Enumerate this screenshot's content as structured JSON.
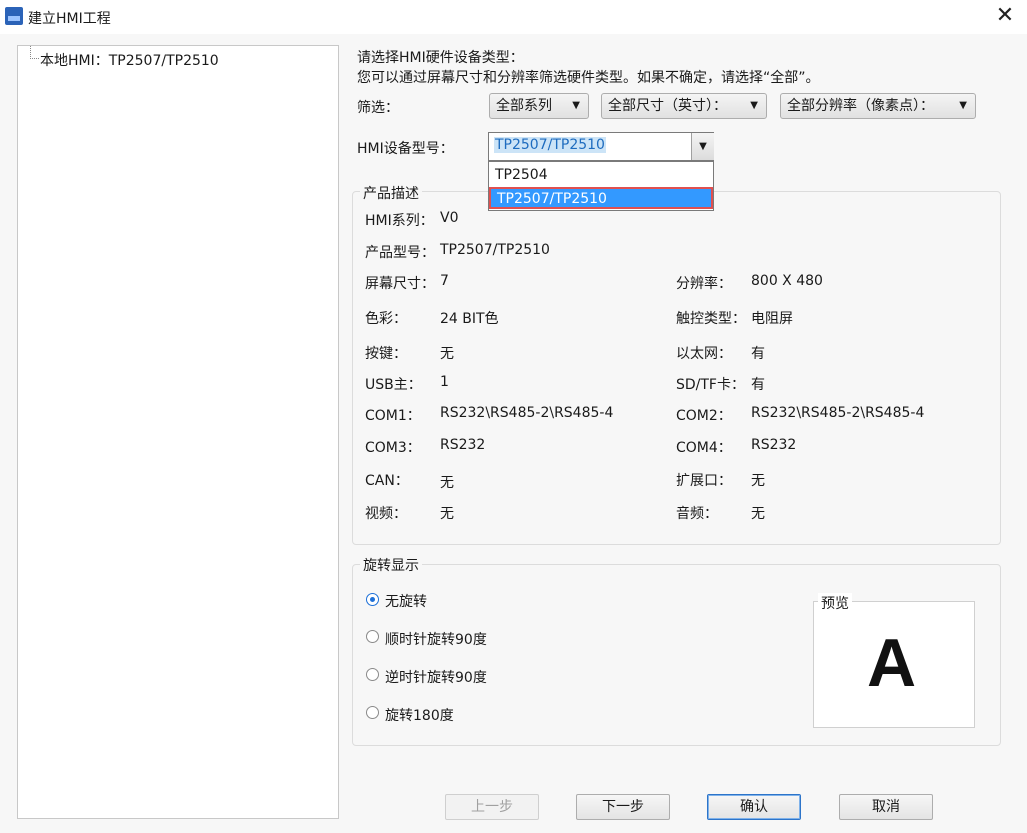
{
  "window": {
    "title": "建立HMI工程",
    "close_glyph": "✕"
  },
  "tree": {
    "item": "本地HMI：TP2507/TP2510"
  },
  "instructions": {
    "line1": "请选择HMI硬件设备类型：",
    "line2": "您可以通过屏幕尺寸和分辨率筛选硬件类型。如果不确定，请选择“全部”。"
  },
  "filter": {
    "label": "筛选：",
    "series": "全部系列",
    "size": "全部尺寸（英寸）：",
    "resolution": "全部分辨率（像素点）："
  },
  "device": {
    "label": "HMI设备型号：",
    "value": "TP2507/TP2510",
    "options": [
      "TP2504",
      "TP2507/TP2510"
    ],
    "selected_index": 1
  },
  "product": {
    "group_title": "产品描述",
    "series_label": "HMI系列：",
    "series_value": "V0",
    "model_label": "产品型号：",
    "model_value": "TP2507/TP2510",
    "screen_label": "屏幕尺寸：",
    "screen_value": "7",
    "resolution_label": "分辨率：",
    "resolution_value": "800 X 480",
    "color_label": "色彩：",
    "color_value": "24 BIT色",
    "touch_label": "触控类型：",
    "touch_value": "电阻屏",
    "keys_label": "按键：",
    "keys_value": "无",
    "ethernet_label": "以太网：",
    "ethernet_value": "有",
    "usb_label": "USB主：",
    "usb_value": "1",
    "sd_label": "SD/TF卡：",
    "sd_value": "有",
    "com1_label": "COM1：",
    "com1_value": "RS232\\RS485-2\\RS485-4",
    "com2_label": "COM2：",
    "com2_value": "RS232\\RS485-2\\RS485-4",
    "com3_label": "COM3：",
    "com3_value": "RS232",
    "com4_label": "COM4：",
    "com4_value": "RS232",
    "can_label": "CAN：",
    "can_value": "无",
    "expansion_label": "扩展口：",
    "expansion_value": "无",
    "video_label": "视频：",
    "video_value": "无",
    "audio_label": "音频：",
    "audio_value": "无"
  },
  "rotation": {
    "group_title": "旋转显示",
    "options": [
      "无旋转",
      "顺时针旋转90度",
      "逆时针旋转90度",
      "旋转180度"
    ],
    "selected_index": 0,
    "preview_title": "预览",
    "preview_letter": "A"
  },
  "buttons": {
    "prev": "上一步",
    "next": "下一步",
    "ok": "确认",
    "cancel": "取消"
  },
  "colors": {
    "selection": "#3399ff",
    "highlight_border": "#e05050"
  },
  "icons": {
    "dropdown_arrow": "▼"
  }
}
